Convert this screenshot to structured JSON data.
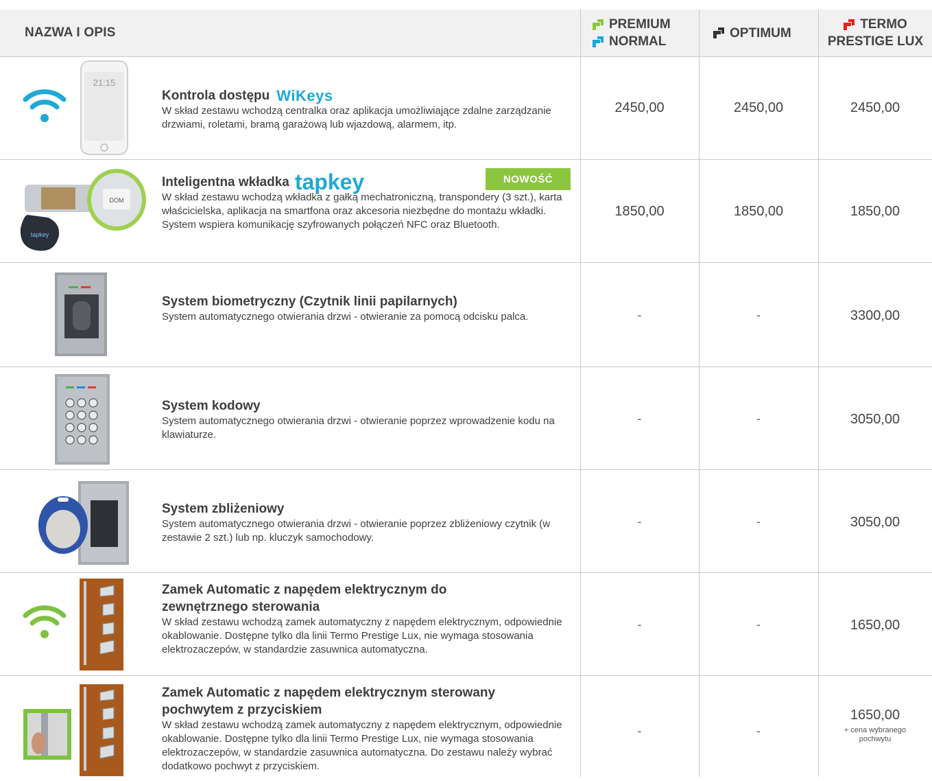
{
  "header": {
    "name_col": "NAZWA I OPIS",
    "col1_line1": "PREMIUM",
    "col1_line2": "NORMAL",
    "col2": "OPTIMUM",
    "col3_line1": "TERMO",
    "col3_line2": "PRESTIGE LUX"
  },
  "colors": {
    "premium": "#8cc63f",
    "normal": "#1aa6dc",
    "optimum": "#333333",
    "termo": "#e2231a",
    "wifi_blue": "#1fa9d6",
    "wifi_green": "#7dc242",
    "badge": "#8cc63f"
  },
  "rows": [
    {
      "title": "Kontrola dostępu",
      "logo": "WiKeys",
      "desc": "W skład zestawu wchodzą centralka oraz aplikacja umożliwiające zdalne zarządzanie drzwiami, roletami, bramą garażową lub wjazdową, alarmem, itp.",
      "prices": [
        "2450,00",
        "2450,00",
        "2450,00"
      ]
    },
    {
      "title": "Inteligentna wkładka",
      "logo": "tapkey",
      "badge": "NOWOŚĆ",
      "desc": "W skład zestawu wchodzą wkładka z gałką mechatroniczną, transpondery (3 szt.), karta właścicielska, aplikacja na smartfona oraz akcesoria niezbędne do montażu wkładki. System wspiera komunikację szyfrowanych połączeń NFC oraz Bluetooth.",
      "prices": [
        "1850,00",
        "1850,00",
        "1850,00"
      ]
    },
    {
      "title": "System biometryczny (Czytnik linii papilarnych)",
      "desc": "System automatycznego otwierania drzwi - otwieranie za pomocą odcisku palca.",
      "prices": [
        "-",
        "-",
        "3300,00"
      ]
    },
    {
      "title": "System kodowy",
      "desc": "System automatycznego otwierania drzwi - otwieranie poprzez wprowadzenie kodu na klawiaturze.",
      "prices": [
        "-",
        "-",
        "3050,00"
      ]
    },
    {
      "title": "System zbliżeniowy",
      "desc": "System automatycznego otwierania drzwi - otwieranie poprzez zbliżeniowy czytnik (w zestawie 2 szt.) lub np. kluczyk samochodowy.",
      "prices": [
        "-",
        "-",
        "3050,00"
      ]
    },
    {
      "title": "Zamek Automatic z napędem elektrycznym do zewnętrznego sterowania",
      "desc": "W skład zestawu wchodzą zamek automatyczny z napędem elektrycznym, odpowiednie okablowanie. Dostępne tylko dla linii Termo Prestige Lux, nie wymaga stosowania elektrozaczepów, w standardzie zasuwnica automatyczna.",
      "prices": [
        "-",
        "-",
        "1650,00"
      ]
    },
    {
      "title": "Zamek Automatic z napędem elektrycznym sterowany pochwytem z przyciskiem",
      "desc": "W skład zestawu wchodzą zamek automatyczny z napędem elektrycznym, odpowiednie okablowanie. Dostępne tylko dla linii Termo Prestige Lux, nie wymaga stosowania elektrozaczepów, w standardzie zasuwnica automatyczna. Do zestawu należy wybrać dodatkowo pochwyt z przyciskiem.",
      "prices": [
        "-",
        "-",
        "1650,00"
      ],
      "price_note": "+ cena wybranego pochwytu"
    }
  ]
}
